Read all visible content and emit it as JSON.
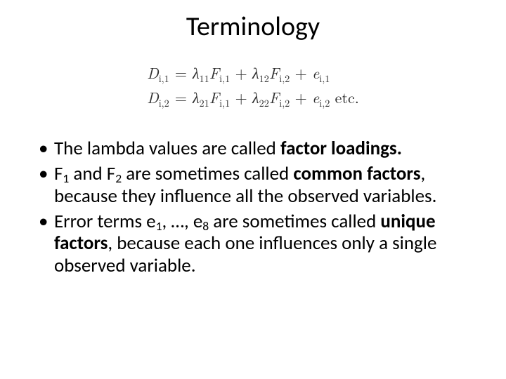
{
  "title": "Terminology",
  "equations": {
    "row1": {
      "lhs_var": "D",
      "lhs_sub": "i,1",
      "rhs": {
        "t1_coef": "λ",
        "t1_coef_sub": "11",
        "t1_var": "F",
        "t1_var_sub": "i,1",
        "t2_coef": "λ",
        "t2_coef_sub": "12",
        "t2_var": "F",
        "t2_var_sub": "i,2",
        "t3_var": "e",
        "t3_var_sub": "i,1"
      },
      "trail": ""
    },
    "row2": {
      "lhs_var": "D",
      "lhs_sub": "i,2",
      "rhs": {
        "t1_coef": "λ",
        "t1_coef_sub": "21",
        "t1_var": "F",
        "t1_var_sub": "i,1",
        "t2_coef": "λ",
        "t2_coef_sub": "22",
        "t2_var": "F",
        "t2_var_sub": "i,2",
        "t3_var": "e",
        "t3_var_sub": "i,2"
      },
      "trail": " etc."
    },
    "eq_sign": "="
  },
  "bullets": {
    "b1": {
      "p1": "The lambda values are called ",
      "bold": "factor loadings.",
      "p2": ""
    },
    "b2": {
      "p1": "F",
      "s1": "1",
      "p2": " and F",
      "s2": "2",
      "p3": " are sometimes called ",
      "bold": "common factors",
      "p4": ", because they influence all the observed variables."
    },
    "b3": {
      "p1": "Error terms e",
      "s1": "1",
      "p2": ", …, e",
      "s2": "8",
      "p3": " are sometimes called ",
      "bold": "unique factors",
      "p4": ", because each one influences only a single observed variable."
    }
  }
}
